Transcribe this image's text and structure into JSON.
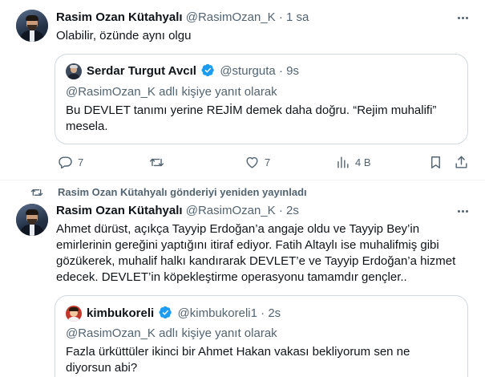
{
  "tweet1": {
    "author_name": "Rasim Ozan Kütahyalı",
    "author_handle": "@RasimOzan_K",
    "separator": "·",
    "time": "1 sa",
    "text": "Olabilir, özünde aynı olgu",
    "quote": {
      "author_name": "Serdar Turgut Avcıl",
      "author_handle": "@sturguta",
      "separator": "·",
      "time": "9s",
      "reply_context": "@RasimOzan_K adlı kişiye yanıt olarak",
      "text": "Bu DEVLET tanımı yerine REJİM demek daha doğru. “Rejim muhalifi” mesela."
    },
    "actions": {
      "replies": "7",
      "retweets": "",
      "likes": "7",
      "views": "4 B"
    }
  },
  "tweet2": {
    "retweet_context": "Rasim Ozan Kütahyalı gönderiyi yeniden yayınladı",
    "author_name": "Rasim Ozan Kütahyalı",
    "author_handle": "@RasimOzan_K",
    "separator": "·",
    "time": "2s",
    "text": "Ahmet dürüst, açıkça Tayyip Erdoğan’a angaje oldu ve Tayyip Bey’in emirlerinin gereğini yaptığını itiraf ediyor. Fatih Altaylı ise muhalifmiş gibi gözükerek, muhalif halkı kandırarak DEVLET’e ve Tayyip Erdoğan’a hizmet edecek. DEVLET’in köpekleştirme operasyonu tamamdır gençler..",
    "quote": {
      "author_name": "kimbukoreli",
      "author_handle": "@kimbukoreli1",
      "separator": "·",
      "time": "2s",
      "reply_context": "@RasimOzan_K adlı kişiye yanıt olarak",
      "text": "Fazla ürküttüler ikinci bir Ahmet Hakan vakası bekliyorum sen ne diyorsun abi?"
    }
  },
  "icons": {
    "reply": "reply-icon",
    "retweet": "retweet-icon",
    "like": "heart-icon",
    "views": "views-icon",
    "bookmark": "bookmark-icon",
    "share": "share-icon",
    "more": "more-icon",
    "verified": "verified-badge-icon"
  },
  "colors": {
    "text": "#0f1419",
    "secondary": "#536471",
    "border": "#cfd9de",
    "verified": "#1d9bf0"
  }
}
